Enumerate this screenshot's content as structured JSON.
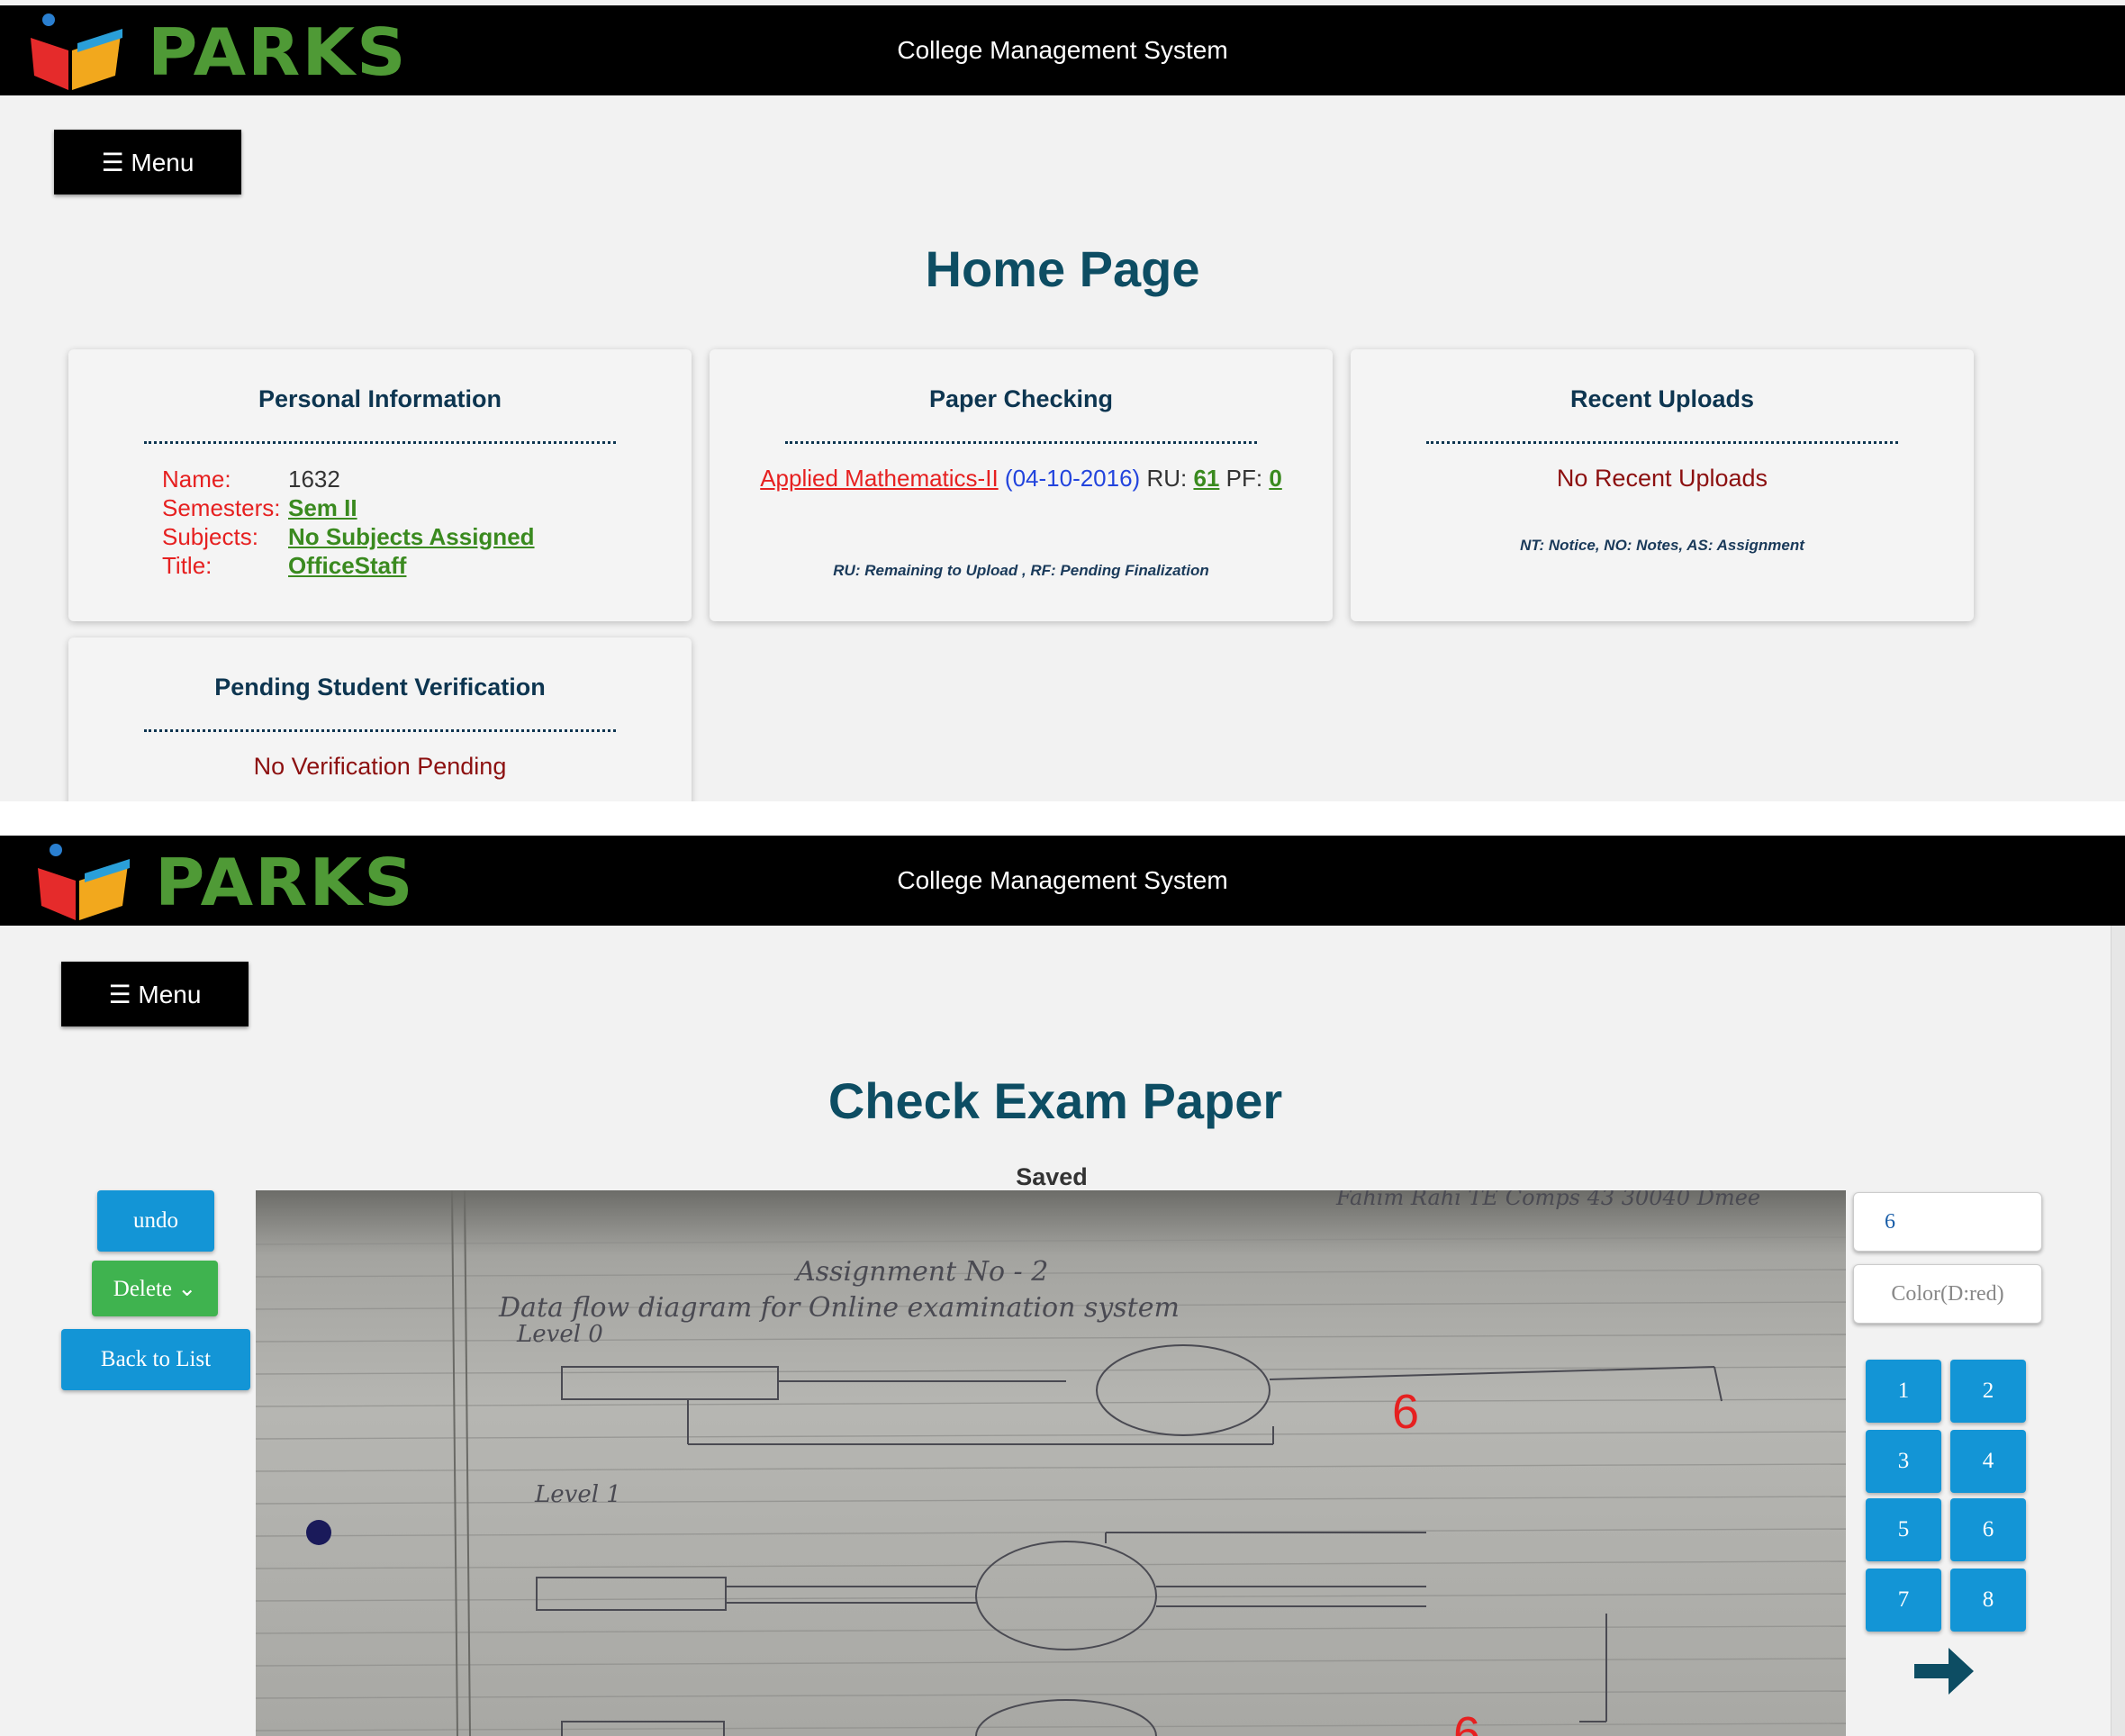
{
  "app": {
    "brand": "PARKS",
    "system_title": "College Management System",
    "menu_label": "☰ Menu"
  },
  "home": {
    "title": "Home Page",
    "personal": {
      "title": "Personal Information",
      "rows": [
        {
          "label": "Name:",
          "value": "1632"
        },
        {
          "label": "Semesters:",
          "value": "Sem II"
        },
        {
          "label": "Subjects:",
          "value": "No Subjects Assigned"
        },
        {
          "label": "Title:",
          "value": "OfficeStaff"
        }
      ]
    },
    "paper_checking": {
      "title": "Paper Checking",
      "subject": "Applied Mathematics-II",
      "date": "(04-10-2016)",
      "ru_label": "RU:",
      "ru_value": "61",
      "pf_label": "PF:",
      "pf_value": "0",
      "legend": "RU: Remaining to Upload , RF: Pending Finalization"
    },
    "recent_uploads": {
      "title": "Recent Uploads",
      "message": "No Recent Uploads",
      "legend": "NT: Notice, NO: Notes, AS: Assignment"
    },
    "pending_verification": {
      "title": "Pending Student Verification",
      "message": "No Verification Pending"
    }
  },
  "check": {
    "title": "Check Exam Paper",
    "status": "Saved",
    "undo_label": "undo",
    "delete_label": "Delete ⌄",
    "back_label": "Back to List",
    "marks_value": "6",
    "color_placeholder": "Color(D:red)",
    "number_buttons": [
      "1",
      "2",
      "3",
      "4",
      "5",
      "6",
      "7",
      "8"
    ],
    "annotation_marks": [
      "6",
      "6"
    ],
    "handwriting": {
      "header": "Fahim Rahi TE Comps 43 30040 Dmee",
      "heading": "Assignment No - 2",
      "question": "Data flow diagram for Online examination system",
      "level0": "Level 0",
      "level1": "Level 1"
    },
    "colors": {
      "primary": "#1395d6",
      "success": "#3fb34f",
      "mark": "#e62020",
      "title": "#0d4d63"
    }
  }
}
